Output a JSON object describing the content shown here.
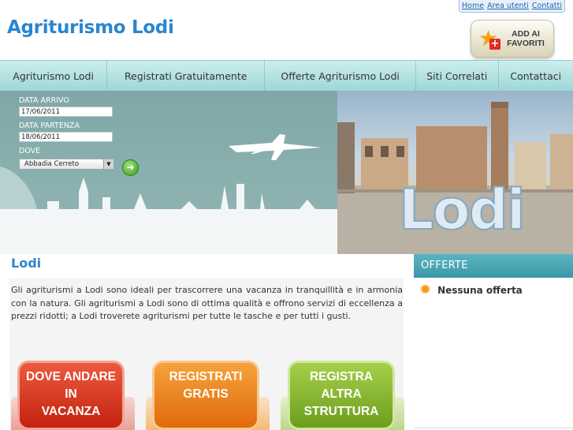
{
  "top_links": [
    "Home",
    "Area utenti",
    "Contatti"
  ],
  "site_title": "Agriturismo Lodi",
  "favorites_button": {
    "label_line1": "ADD AI",
    "label_line2": "FAVORITI"
  },
  "nav": [
    {
      "label": "Agriturismo Lodi"
    },
    {
      "label": "Registrati Gratuitamente"
    },
    {
      "label": "Offerte Agriturismo Lodi"
    },
    {
      "label": "Siti Correlati"
    },
    {
      "label": "Contattaci"
    }
  ],
  "search_form": {
    "arrival_label": "DATA ARRIVO",
    "arrival_value": "17/06/2011",
    "departure_label": "DATA PARTENZA",
    "departure_value": "18/06/2011",
    "where_label": "DOVE",
    "where_value": "Abbadia Cerreto"
  },
  "banner_photo_text": "Lodi",
  "section_title": "Lodi",
  "intro_text": "Gli agriturismi a Lodi sono ideali per trascorrere una vacanza in tranquillità e in armonia con la natura. Gli agriturismi a Lodi sono di ottima qualità e offrono servizi di eccellenza a prezzi ridotti; a Lodi troverete agriturismi per tutte le tasche e per tutti i gusti.",
  "buttons": {
    "dove": {
      "l1": "DOVE ANDARE",
      "l2": "IN",
      "l3": "VACANZA"
    },
    "registrati": {
      "l1": "REGISTRATI",
      "l2": "GRATIS"
    },
    "registra": {
      "l1": "REGISTRA",
      "l2": "ALTRA",
      "l3": "STRUTTURA"
    }
  },
  "sidebar": {
    "heading": "OFFERTE",
    "item": "Nessuna offerta"
  },
  "colors": {
    "title_blue": "#2a86cf",
    "nav_teal": "#9ed6d6",
    "btn_red": "#d9301f",
    "btn_orange": "#f07d14",
    "btn_green": "#7cb02a"
  }
}
